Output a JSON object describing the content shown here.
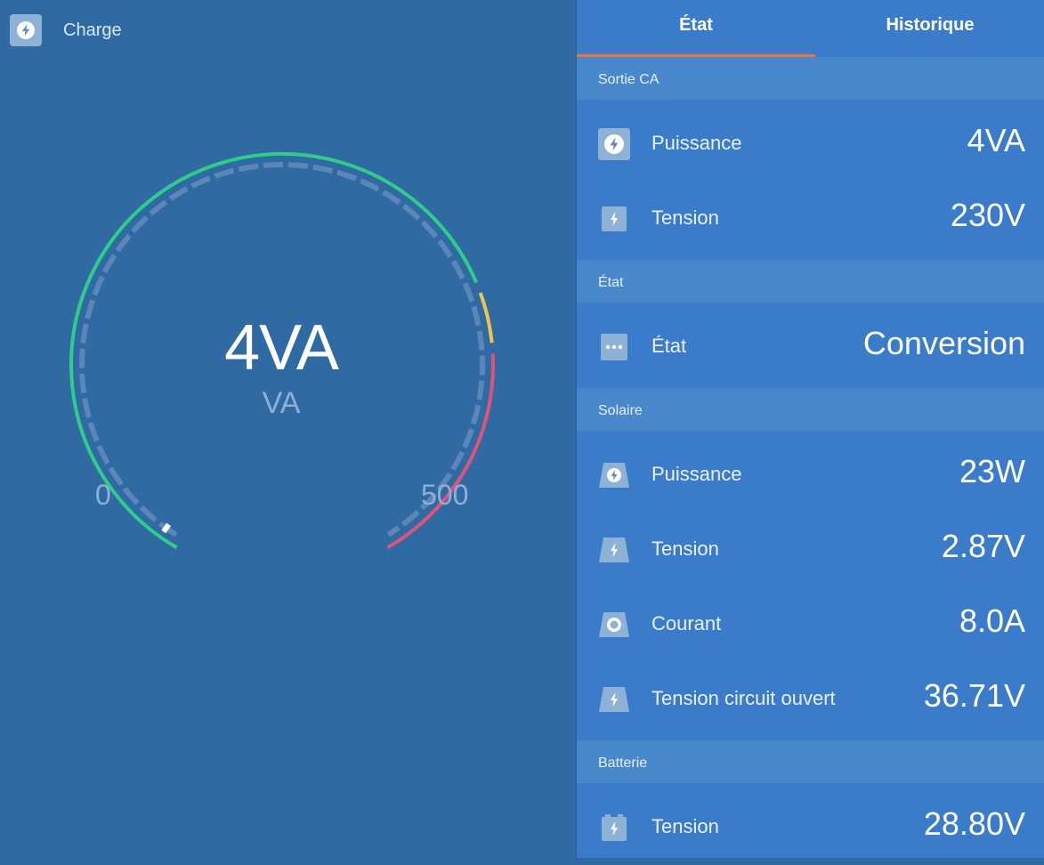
{
  "left": {
    "header": {
      "icon": "bolt-circle-icon",
      "label": "Charge"
    },
    "gauge": {
      "value_display": "4VA",
      "unit": "VA",
      "min_label": "0",
      "max_label": "500",
      "value": 4,
      "min": 0,
      "max": 500,
      "colors": {
        "normal": "#2fcc8b",
        "warning": "#f0c44a",
        "alarm": "#e0537a",
        "needle": "#ffffff"
      }
    }
  },
  "tabs": [
    {
      "label": "État",
      "active": true
    },
    {
      "label": "Historique",
      "active": false
    }
  ],
  "sections": {
    "sortie_ca": {
      "title": "Sortie CA",
      "rows": [
        {
          "icon": "bolt-circle-icon",
          "label": "Puissance",
          "value": "4VA"
        },
        {
          "icon": "bolt-square-icon",
          "label": "Tension",
          "value": "230V"
        }
      ]
    },
    "etat": {
      "title": "État",
      "rows": [
        {
          "icon": "more-dots-icon",
          "label": "État",
          "value": "Conversion"
        }
      ]
    },
    "solaire": {
      "title": "Solaire",
      "rows": [
        {
          "icon": "solar-power-icon",
          "label": "Puissance",
          "value": "23W"
        },
        {
          "icon": "solar-voltage-icon",
          "label": "Tension",
          "value": "2.87V"
        },
        {
          "icon": "solar-current-icon",
          "label": "Courant",
          "value": "8.0A"
        },
        {
          "icon": "solar-voltage-icon",
          "label": "Tension circuit ouvert",
          "value": "36.71V"
        }
      ]
    },
    "batterie": {
      "title": "Batterie",
      "rows": [
        {
          "icon": "battery-icon",
          "label": "Tension",
          "value": "28.80V"
        }
      ]
    }
  },
  "accent": "#f0743e"
}
